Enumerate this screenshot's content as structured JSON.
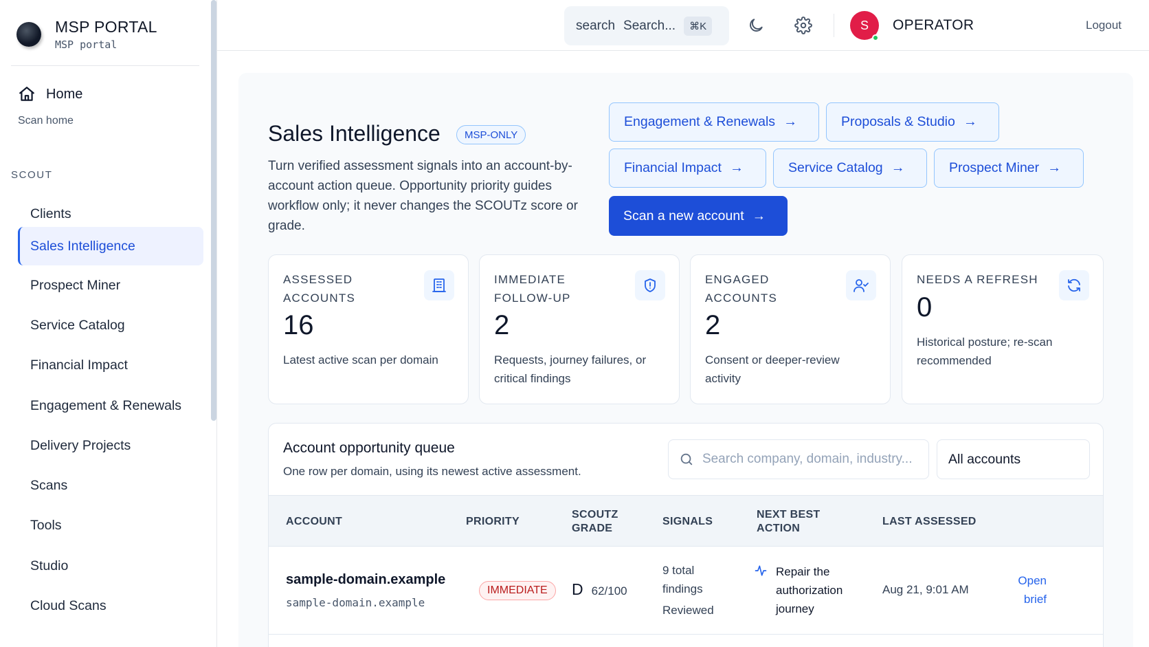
{
  "brand": {
    "title": "MSP PORTAL",
    "subtitle": "MSP portal"
  },
  "sidebar": {
    "home_label": "Home",
    "home_sub": "Scan home",
    "section_label": "SCOUT",
    "items": [
      {
        "label": "Clients"
      },
      {
        "label": "Sales Intelligence",
        "active": true
      },
      {
        "label": "Prospect Miner"
      },
      {
        "label": "Service Catalog"
      },
      {
        "label": "Financial Impact"
      },
      {
        "label": "Engagement & Renewals"
      },
      {
        "label": "Delivery Projects"
      },
      {
        "label": "Scans"
      },
      {
        "label": "Tools"
      },
      {
        "label": "Studio"
      },
      {
        "label": "Cloud Scans"
      }
    ]
  },
  "topbar": {
    "search_icon_text": "search",
    "search_placeholder": "Search...",
    "search_shortcut": "⌘K",
    "avatar_initial": "S",
    "user_name": "OPERATOR",
    "logout_label": "Logout"
  },
  "page": {
    "title": "Sales Intelligence",
    "badge": "MSP-ONLY",
    "description": "Turn verified assessment signals into an account-by-account action queue. Opportunity priority guides workflow only; it never changes the SCOUTz score or grade."
  },
  "actions": {
    "engagement": "Engagement & Renewals",
    "proposals": "Proposals & Studio",
    "financial": "Financial Impact",
    "catalog": "Service Catalog",
    "miner": "Prospect Miner",
    "scan_new": "Scan a new account",
    "arrow": "→"
  },
  "stats": [
    {
      "label": "ASSESSED ACCOUNTS",
      "value": "16",
      "desc": "Latest active scan per domain",
      "icon": "building-icon"
    },
    {
      "label": "IMMEDIATE FOLLOW-UP",
      "value": "2",
      "desc": "Requests, journey failures, or critical findings",
      "icon": "shield-alert-icon"
    },
    {
      "label": "ENGAGED ACCOUNTS",
      "value": "2",
      "desc": "Consent or deeper-review activity",
      "icon": "user-check-icon"
    },
    {
      "label": "NEEDS A REFRESH",
      "value": "0",
      "desc": "Historical posture; re-scan recommended",
      "icon": "refresh-icon"
    }
  ],
  "queue": {
    "title": "Account opportunity queue",
    "subtitle": "One row per domain, using its newest active assessment.",
    "search_placeholder": "Search company, domain, industry...",
    "filter_value": "All accounts",
    "columns": {
      "account": "ACCOUNT",
      "priority": "PRIORITY",
      "grade_1": "SCOUTZ",
      "grade_2": "GRADE",
      "signals": "SIGNALS",
      "action_1": "NEXT BEST",
      "action_2": "ACTION",
      "last": "LAST ASSESSED"
    },
    "rows": [
      {
        "account": "sample-domain.example",
        "domain": "sample-domain.example",
        "priority": "IMMEDIATE",
        "grade": "D",
        "score": "62/100",
        "signals_1": "9 total",
        "signals_2": "findings",
        "signals_3": "Reviewed",
        "action_1": "Repair the",
        "action_2": "authorization",
        "action_3": "journey",
        "last_assessed": "Aug 21, 9:01 AM",
        "open_1": "Open",
        "open_2": "brief"
      }
    ]
  }
}
